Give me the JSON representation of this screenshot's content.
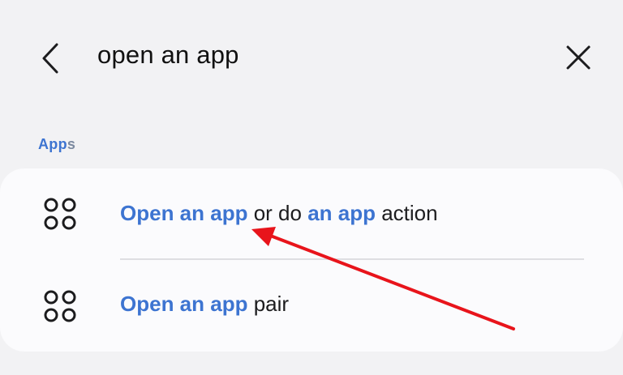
{
  "header": {
    "back_icon": "chevron-left-icon",
    "search_text": "open an app",
    "close_icon": "close-icon"
  },
  "section": {
    "label_highlight": "App",
    "label_rest": "s"
  },
  "results": [
    {
      "icon": "apps-grid-icon",
      "parts": [
        "Open an app",
        " or do ",
        "an app",
        " action"
      ]
    },
    {
      "icon": "apps-grid-icon",
      "parts": [
        "Open an app",
        " pair"
      ]
    }
  ],
  "colors": {
    "accent": "#3d74d1",
    "background": "#f2f2f4",
    "card": "#fbfbfd",
    "annotation_arrow": "#e8141b"
  }
}
